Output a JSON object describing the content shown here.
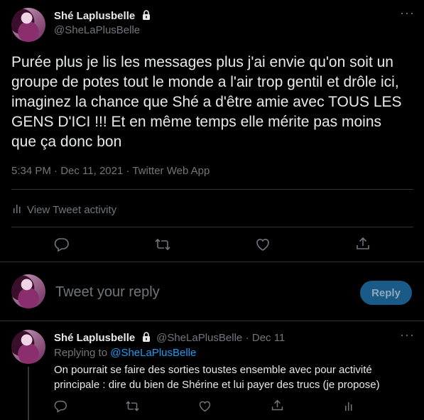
{
  "main_tweet": {
    "display_name": "Shé Laplusbelle",
    "handle": "@SheLaPlusBelle",
    "text": "Purée plus je lis les messages plus j'ai envie qu'on soit un groupe de potes tout le monde a l'air trop gentil et drôle ici, imaginez la chance que Shé a d'être amie avec TOUS LES GENS D'ICI !!! Et en même temps elle mérite pas moins que ça donc bon",
    "timestamp": "5:34 PM · Dec 11, 2021 · Twitter Web App",
    "activity_label": "View Tweet activity"
  },
  "composer": {
    "placeholder": "Tweet your reply",
    "reply_button": "Reply"
  },
  "reply_tweet": {
    "display_name": "Shé Laplusbelle",
    "handle": "@SheLaPlusBelle",
    "date": "· Dec 11",
    "replying_prefix": "Replying to",
    "replying_to": "@SheLaPlusBelle",
    "text": "On pourrait se faire des sorties toustes ensemble avec pour activité principale : dire du bien de Shérine et lui payer des trucs (je propose)"
  },
  "colors": {
    "background": "#000000",
    "text": "#e7e9ea",
    "muted": "#71767b",
    "accent": "#1d9bf0",
    "divider": "#2f3336"
  },
  "icons": [
    "lock-icon",
    "more-icon",
    "activity-icon",
    "reply-icon",
    "retweet-icon",
    "like-icon",
    "share-icon"
  ]
}
